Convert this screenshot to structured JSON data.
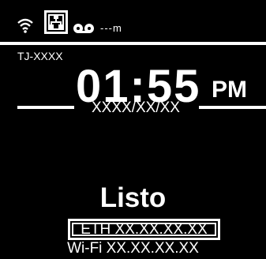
{
  "status_bar": {
    "icons": [
      "wifi-icon",
      "ethernet-icon",
      "tape-icon"
    ],
    "signal_text": "---m"
  },
  "device_name": "TJ-XXXX",
  "clock": {
    "time": "01:55",
    "ampm": "PM",
    "date": "XXXX/XX/XX"
  },
  "status_text": "Listo",
  "network": {
    "eth": "ETH XX.XX.XX.XX",
    "wifi": "Wi-Fi XX.XX.XX.XX"
  },
  "colors": {
    "background": "#000000",
    "foreground": "#ffffff"
  }
}
